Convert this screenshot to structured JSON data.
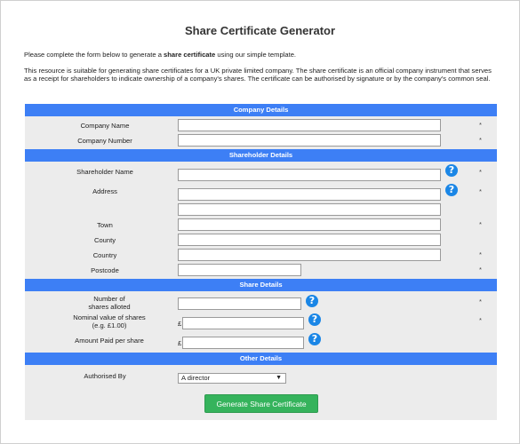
{
  "title": "Share Certificate Generator",
  "intro": {
    "p1_before": "Please complete the form below to generate a ",
    "p1_bold": "share certificate",
    "p1_after": " using our simple template.",
    "p2": "This resource is suitable for generating share certificates for a UK private limited company. The share certificate is an official company instrument that serves as a receipt for shareholders to indicate ownership of a company's shares. The certificate can be authorised by signature or by the company's common seal."
  },
  "sections": {
    "company": "Company Details",
    "shareholder": "Shareholder Details",
    "share": "Share Details",
    "other": "Other Details"
  },
  "labels": {
    "company_name": "Company Name",
    "company_number": "Company Number",
    "shareholder_name": "Shareholder Name",
    "address": "Address",
    "town": "Town",
    "county": "County",
    "country": "Country",
    "postcode": "Postcode",
    "shares_allotted_l1": "Number of",
    "shares_allotted_l2": "shares alloted",
    "nominal_l1": "Nominal value of shares",
    "nominal_l2": "(e.g. £1.00)",
    "amount_paid": "Amount Paid per share",
    "authorised_by": "Authorised By"
  },
  "currency_symbol": "£",
  "required_marker": "*",
  "help_glyph": "?",
  "authorised_by": {
    "selected": "A director"
  },
  "submit_label": "Generate Share Certificate",
  "colors": {
    "section_bar": "#3d7ff5",
    "form_bg": "#ececec",
    "help_icon": "#1a86e6",
    "button": "#35b35c"
  }
}
